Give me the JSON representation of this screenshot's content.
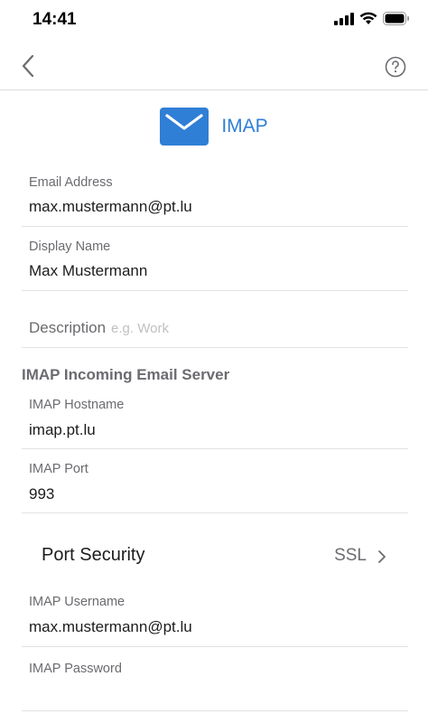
{
  "status_bar": {
    "time": "14:41"
  },
  "nav": {
    "back_icon": "chevron-left-icon",
    "help_icon": "question-circle-icon"
  },
  "header": {
    "title": "IMAP",
    "icon": "envelope-icon",
    "accent": "#2f7fd6"
  },
  "fields": {
    "email": {
      "label": "Email Address",
      "value": "max.mustermann@pt.lu"
    },
    "display_name": {
      "label": "Display Name",
      "value": "Max Mustermann"
    },
    "description": {
      "label": "Description",
      "placeholder": "e.g. Work",
      "value": ""
    }
  },
  "incoming": {
    "section_title": "IMAP Incoming Email Server",
    "hostname": {
      "label": "IMAP Hostname",
      "value": "imap.pt.lu"
    },
    "port": {
      "label": "IMAP Port",
      "value": "993"
    },
    "port_security": {
      "label": "Port Security",
      "value": "SSL"
    },
    "username": {
      "label": "IMAP Username",
      "value": "max.mustermann@pt.lu"
    },
    "password": {
      "label": "IMAP Password",
      "value": ""
    }
  }
}
